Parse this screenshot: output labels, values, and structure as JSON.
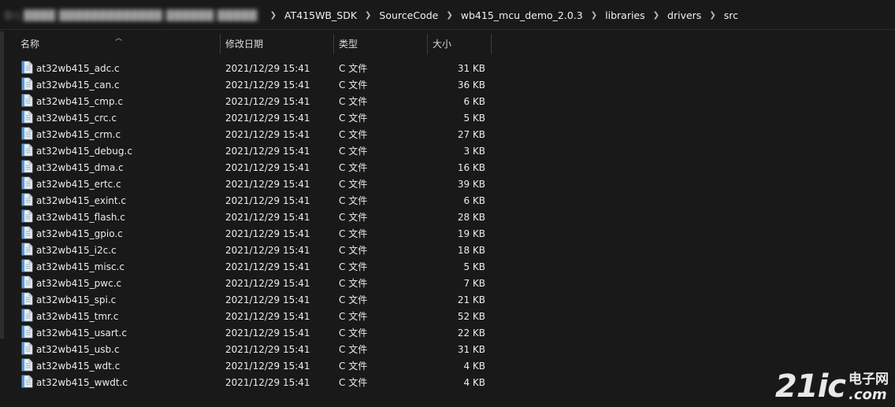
{
  "breadcrumb": {
    "blurred_prefix": "D:\\ ████ █████████████ ██████ █████",
    "items": [
      "AT415WB_SDK",
      "SourceCode",
      "wb415_mcu_demo_2.0.3",
      "libraries",
      "drivers",
      "src"
    ]
  },
  "columns": {
    "name": "名称",
    "date": "修改日期",
    "type": "类型",
    "size": "大小"
  },
  "files": [
    {
      "name": "at32wb415_adc.c",
      "date": "2021/12/29 15:41",
      "type": "C 文件",
      "size": "31 KB"
    },
    {
      "name": "at32wb415_can.c",
      "date": "2021/12/29 15:41",
      "type": "C 文件",
      "size": "36 KB"
    },
    {
      "name": "at32wb415_cmp.c",
      "date": "2021/12/29 15:41",
      "type": "C 文件",
      "size": "6 KB"
    },
    {
      "name": "at32wb415_crc.c",
      "date": "2021/12/29 15:41",
      "type": "C 文件",
      "size": "5 KB"
    },
    {
      "name": "at32wb415_crm.c",
      "date": "2021/12/29 15:41",
      "type": "C 文件",
      "size": "27 KB"
    },
    {
      "name": "at32wb415_debug.c",
      "date": "2021/12/29 15:41",
      "type": "C 文件",
      "size": "3 KB"
    },
    {
      "name": "at32wb415_dma.c",
      "date": "2021/12/29 15:41",
      "type": "C 文件",
      "size": "16 KB"
    },
    {
      "name": "at32wb415_ertc.c",
      "date": "2021/12/29 15:41",
      "type": "C 文件",
      "size": "39 KB"
    },
    {
      "name": "at32wb415_exint.c",
      "date": "2021/12/29 15:41",
      "type": "C 文件",
      "size": "6 KB"
    },
    {
      "name": "at32wb415_flash.c",
      "date": "2021/12/29 15:41",
      "type": "C 文件",
      "size": "28 KB"
    },
    {
      "name": "at32wb415_gpio.c",
      "date": "2021/12/29 15:41",
      "type": "C 文件",
      "size": "19 KB"
    },
    {
      "name": "at32wb415_i2c.c",
      "date": "2021/12/29 15:41",
      "type": "C 文件",
      "size": "18 KB"
    },
    {
      "name": "at32wb415_misc.c",
      "date": "2021/12/29 15:41",
      "type": "C 文件",
      "size": "5 KB"
    },
    {
      "name": "at32wb415_pwc.c",
      "date": "2021/12/29 15:41",
      "type": "C 文件",
      "size": "7 KB"
    },
    {
      "name": "at32wb415_spi.c",
      "date": "2021/12/29 15:41",
      "type": "C 文件",
      "size": "21 KB"
    },
    {
      "name": "at32wb415_tmr.c",
      "date": "2021/12/29 15:41",
      "type": "C 文件",
      "size": "52 KB"
    },
    {
      "name": "at32wb415_usart.c",
      "date": "2021/12/29 15:41",
      "type": "C 文件",
      "size": "22 KB"
    },
    {
      "name": "at32wb415_usb.c",
      "date": "2021/12/29 15:41",
      "type": "C 文件",
      "size": "31 KB"
    },
    {
      "name": "at32wb415_wdt.c",
      "date": "2021/12/29 15:41",
      "type": "C 文件",
      "size": "4 KB"
    },
    {
      "name": "at32wb415_wwdt.c",
      "date": "2021/12/29 15:41",
      "type": "C 文件",
      "size": "4 KB"
    }
  ],
  "watermark": {
    "big": "21ic",
    "cn": "电子网",
    "com": ".com"
  },
  "icons": {
    "file": "c-source-file-icon",
    "separator": "chevron-right-icon",
    "sort": "sort-ascending-icon"
  },
  "colors": {
    "background": "#191919",
    "text": "#ececec"
  }
}
